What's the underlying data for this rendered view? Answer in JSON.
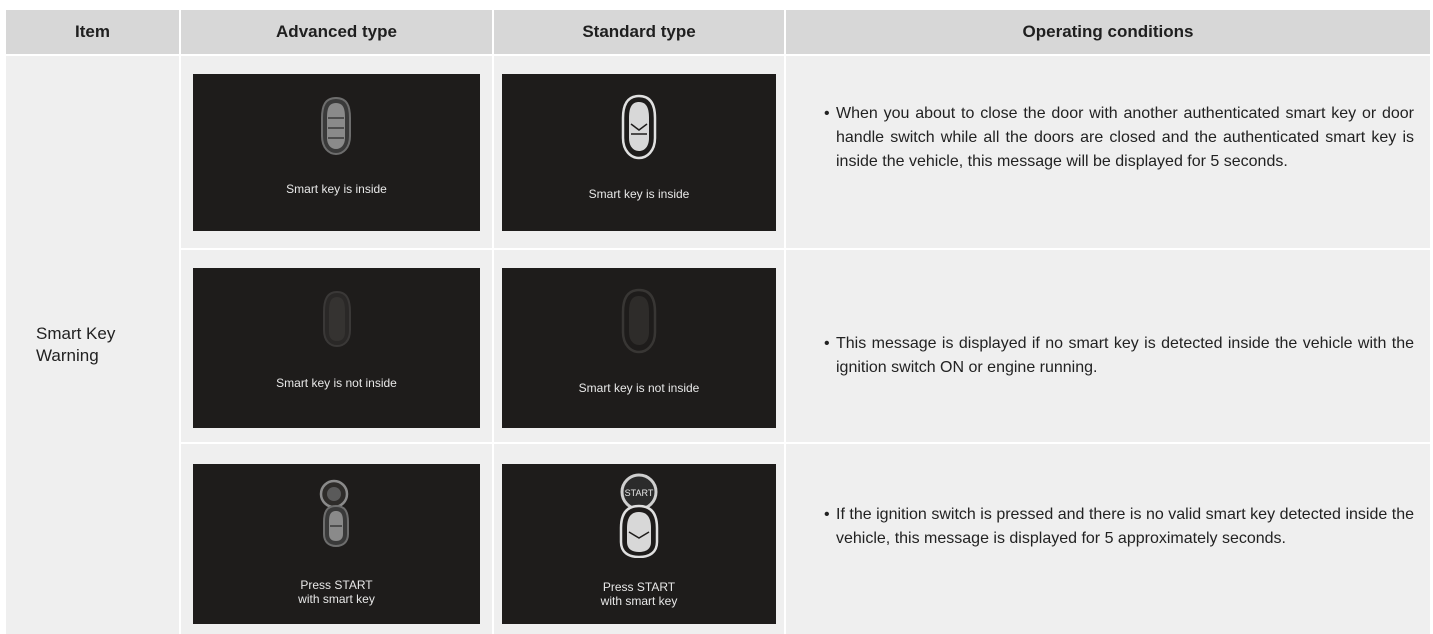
{
  "headers": {
    "item": "Item",
    "advanced": "Advanced type",
    "standard": "Standard type",
    "conditions": "Operating conditions"
  },
  "item_label": "Smart Key Warning",
  "rows": [
    {
      "advanced_msg": "Smart key is inside",
      "standard_msg": "Smart key is inside",
      "condition": "When you about to close the door with another authenticated smart key or door handle switch while all the doors are closed and the authenticated smart key is inside the vehicle, this message will be displayed for 5 seconds."
    },
    {
      "advanced_msg": "Smart key is not inside",
      "standard_msg": "Smart key is not inside",
      "condition": "This message is displayed if no smart key is detected inside the vehicle with the ignition switch ON or engine running."
    },
    {
      "advanced_msg_line1": "Press START",
      "advanced_msg_line2": "with smart key",
      "standard_msg_line1": "Press START",
      "standard_msg_line2": "with smart key",
      "standard_icon_text": "START",
      "condition": "If the ignition switch is pressed and there is no valid smart key detected inside the vehicle, this message is displayed for 5 approximately seconds."
    }
  ],
  "bullet": "•",
  "icons": [
    "smart-key-icon",
    "ignition-start-icon"
  ],
  "colors": {
    "header_bg": "#d7d7d7",
    "cell_bg": "#efefef",
    "screen_bg": "#1e1c1b"
  }
}
